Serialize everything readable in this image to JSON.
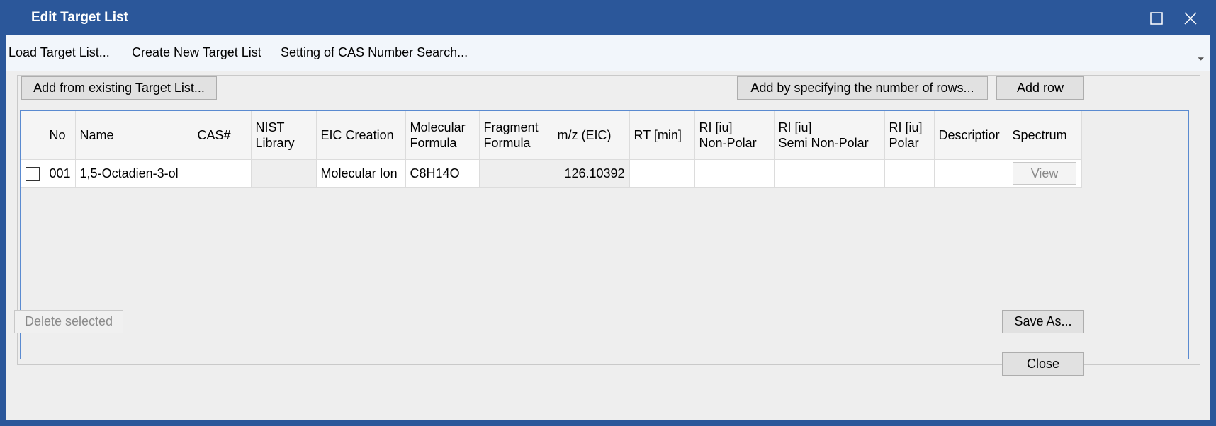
{
  "window": {
    "title": "Edit Target List",
    "maximize_icon": "maximize-icon",
    "close_icon": "close-icon"
  },
  "menu": {
    "items": [
      "Load Target List...",
      "Create New Target List",
      "Setting of CAS Number Search..."
    ],
    "overflow_icon": "overflow-chevron-icon"
  },
  "toolbar": {
    "add_from_existing": "Add from existing Target List...",
    "add_by_rows": "Add by specifying the number of rows...",
    "add_row": "Add row"
  },
  "table": {
    "columns": [
      "",
      "No",
      "Name",
      "CAS#",
      "NIST\nLibrary",
      "EIC Creation",
      "Molecular\nFormula",
      "Fragment\nFormula",
      "m/z (EIC)",
      "RT [min]",
      "RI [iu]\nNon-Polar",
      "RI [iu]\nSemi Non-Polar",
      "RI [iu]\nPolar",
      "Descriptior",
      "Spectrum"
    ],
    "rows": [
      {
        "checked": false,
        "no": "001",
        "name": "1,5-Octadien-3-ol",
        "cas": "",
        "nist": "",
        "eic_creation": "Molecular Ion",
        "molecular_formula": "C8H14O",
        "fragment_formula": "",
        "mz": "126.10392",
        "rt": "",
        "ri_nonpolar": "",
        "ri_seminonpolar": "",
        "ri_polar": "",
        "description": "",
        "spectrum_button": "View"
      }
    ]
  },
  "footer": {
    "delete_selected": "Delete selected",
    "save_as": "Save As...",
    "close": "Close"
  },
  "colors": {
    "titlebar": "#2b579a",
    "grid_border": "#5a8ad0",
    "menubar": "#f2f6fb"
  }
}
